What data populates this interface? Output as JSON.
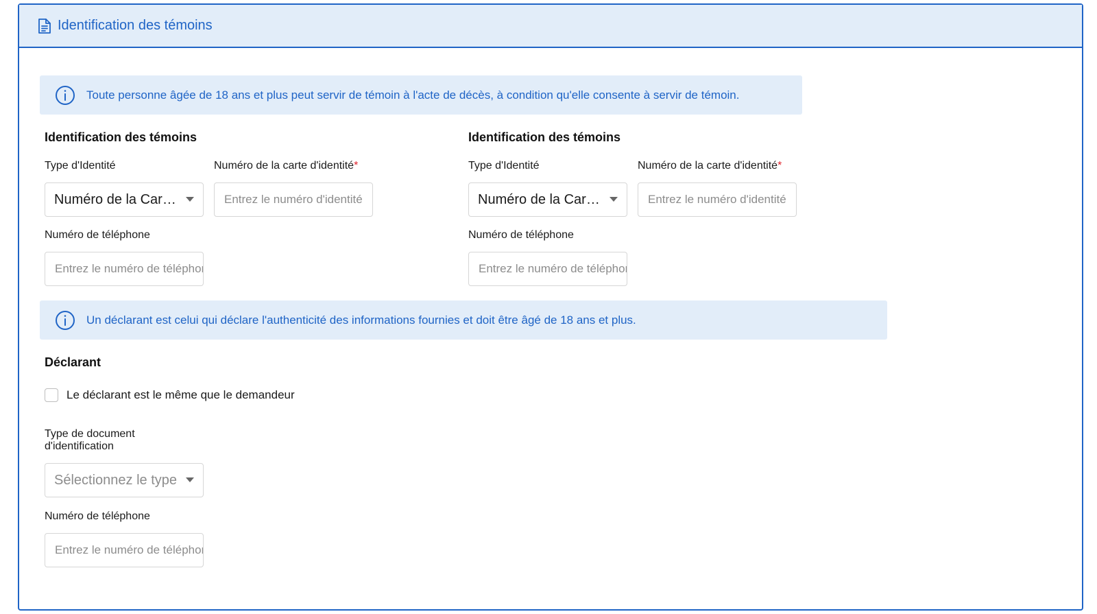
{
  "header": {
    "title": "Identification des témoins",
    "icon": "document-icon"
  },
  "info_witness": {
    "icon": "info-icon",
    "text": "Toute personne âgée de 18 ans et plus peut servir de témoin à l'acte de décès, à condition qu'elle consente à servir de témoin."
  },
  "witness1": {
    "heading": "Identification des témoins",
    "id_type_label": "Type d'Identité",
    "id_type_value": "Numéro de la Carte d'Identité",
    "id_number_label": "Numéro de la carte d'identité",
    "id_number_required": "*",
    "id_number_placeholder": "Entrez le numéro d'identité",
    "phone_label": "Numéro de téléphone",
    "phone_placeholder": "Entrez le numéro de téléphone"
  },
  "witness2": {
    "heading": "Identification des témoins",
    "id_type_label": "Type d'Identité",
    "id_type_value": "Numéro de la Carte d'Identité",
    "id_number_label": "Numéro de la carte d'identité",
    "id_number_required": "*",
    "id_number_placeholder": "Entrez le numéro d'identité",
    "phone_label": "Numéro de téléphone",
    "phone_placeholder": "Entrez le numéro de téléphone"
  },
  "info_declarant": {
    "icon": "info-icon",
    "text": "Un déclarant est celui qui déclare l'authenticité des informations fournies et doit être âgé de 18 ans et plus."
  },
  "declarant": {
    "heading": "Déclarant",
    "same_as_applicant_label": "Le déclarant est le même que le demandeur",
    "same_as_applicant_checked": false,
    "doc_type_label_line1": "Type de document",
    "doc_type_label_line2": "d'identification",
    "doc_type_placeholder": "Sélectionnez le type de document",
    "phone_label": "Numéro de téléphone",
    "phone_placeholder": "Entrez le numéro de téléphone"
  },
  "colors": {
    "accent": "#1f64c6",
    "info_background": "#e2edf9",
    "required": "#e0242d"
  }
}
